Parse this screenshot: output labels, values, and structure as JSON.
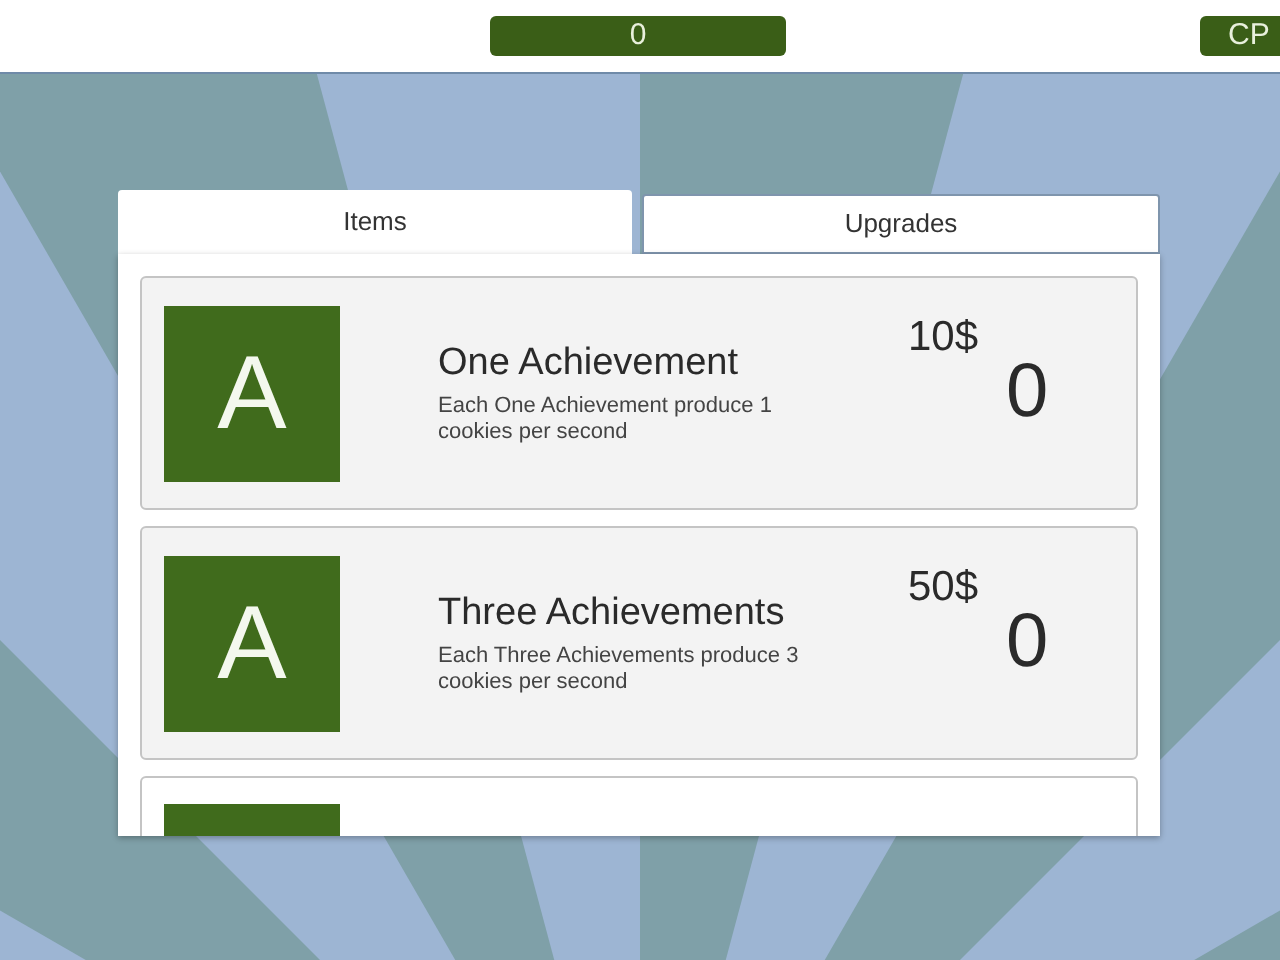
{
  "top_bar": {
    "cookie_count": "0",
    "cps_label": "CP"
  },
  "tabs": [
    {
      "label": "Items",
      "selected": true
    },
    {
      "label": "Upgrades",
      "selected": false
    }
  ],
  "items": [
    {
      "icon_letter": "A",
      "title": "One Achievement",
      "description": "Each One Achievement  produce 1 cookies per second",
      "price": "10$",
      "owned": "0"
    },
    {
      "icon_letter": "A",
      "title": "Three Achievements",
      "description": "Each Three Achievements produce 3 cookies per second",
      "price": "50$",
      "owned": "0"
    }
  ],
  "more_items_below": true
}
